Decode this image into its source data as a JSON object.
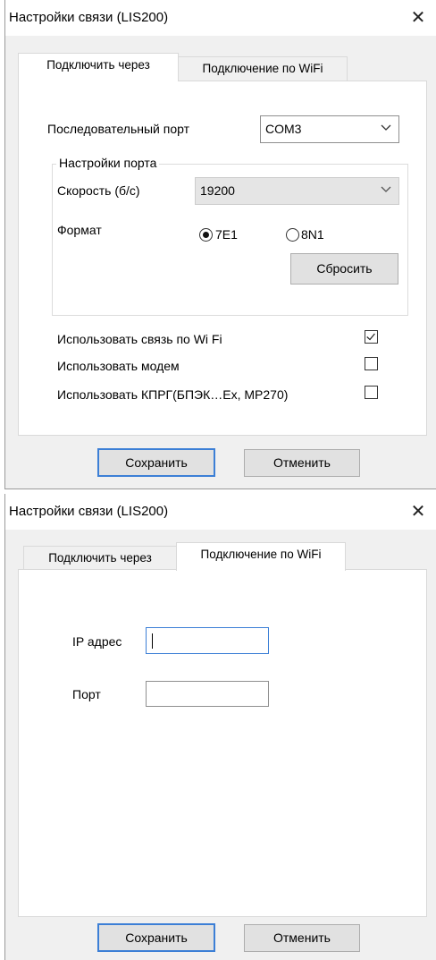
{
  "dialog1": {
    "title": "Настройки связи (LIS200)",
    "tabs": [
      "Подключить через",
      "Подключение по WiFi"
    ],
    "serial_port_label": "Последовательный порт",
    "serial_port_value": "COM3",
    "port_settings_label": "Настройки порта",
    "speed_label": "Скорость (б/с)",
    "speed_value": "19200",
    "format_label": "Формат",
    "format_options": [
      "7E1",
      "8N1"
    ],
    "format_selected": "7E1",
    "reset_button": "Сбросить",
    "checkboxes": [
      {
        "label": "Использовать связь по Wi Fi",
        "checked": true
      },
      {
        "label": "Использовать модем",
        "checked": false
      },
      {
        "label": "Использовать КПРГ(БПЭК…Ex, MP270)",
        "checked": false
      }
    ],
    "save_button": "Сохранить",
    "cancel_button": "Отменить"
  },
  "dialog2": {
    "title": "Настройки связи (LIS200)",
    "tabs": [
      "Подключить через",
      "Подключение по WiFi"
    ],
    "ip_label": "IP адрес",
    "ip_value": "",
    "port_label": "Порт",
    "port_value": "",
    "save_button": "Сохранить",
    "cancel_button": "Отменить"
  },
  "colors": {
    "accent": "#3c7fd6",
    "window_bg": "#f0f0f0",
    "panel_bg": "#ffffff"
  },
  "icons": {
    "close": "close-icon",
    "dropdown": "chevron-down-icon",
    "check": "check-icon"
  }
}
